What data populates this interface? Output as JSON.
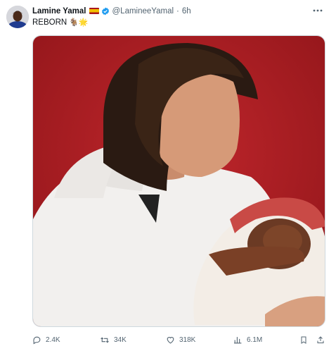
{
  "author": {
    "name": "Lamine Yamal",
    "handle": "@LamineeYamal",
    "time": "6h",
    "flag_icon": "spain-flag-icon",
    "verified_icon": "verified-badge-icon"
  },
  "tweet": {
    "text": "REBORN",
    "emojis": "🐐🌟"
  },
  "media": {
    "image_icon": "photo-man-holding-baby"
  },
  "actions": {
    "replies": "2.4K",
    "reposts": "34K",
    "likes": "318K",
    "views": "6.1M"
  },
  "colors": {
    "text": "#0f1419",
    "secondary": "#536471",
    "verified": "#1d9bf0",
    "background_red": "#b31f25"
  }
}
